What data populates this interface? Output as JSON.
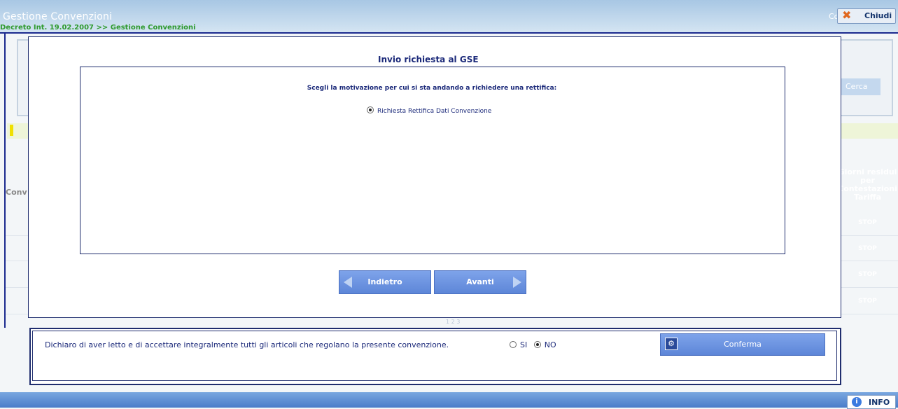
{
  "header": {
    "title": "Gestione Convenzioni",
    "breadcrumb": "Decreto Int. 19.02.2007 >> Gestione Convenzioni",
    "co_fragment": "Co",
    "close_label": "Chiudi"
  },
  "background": {
    "search_button": "Cerca",
    "column_header": "Giorni residui per Contestazioni Tariffa",
    "conv_fragment": "Conv",
    "stop_labels": [
      "STOP",
      "STOP",
      "STOP",
      "STOP"
    ],
    "pagination": "1 2 3"
  },
  "modal": {
    "title": "Invio richiesta al GSE",
    "question": "Scegli la motivazione per cui si sta andando a richiedere una rettifica:",
    "option_label": "Richiesta Rettifica Dati Convenzione",
    "option_selected": true,
    "back_label": "Indietro",
    "next_label": "Avanti"
  },
  "declaration": {
    "text": "Dichiaro di aver letto e di accettare integralmente tutti gli articoli che regolano la presente convenzione.",
    "yes_label": "SI",
    "no_label": "NO",
    "selected": "NO",
    "confirm_label": "Conferma"
  },
  "footer": {
    "info_label": "INFO"
  },
  "colors": {
    "navy": "#1c2a7a",
    "button_blue": "#6a92df",
    "header_blue": "#a8c7e4"
  }
}
